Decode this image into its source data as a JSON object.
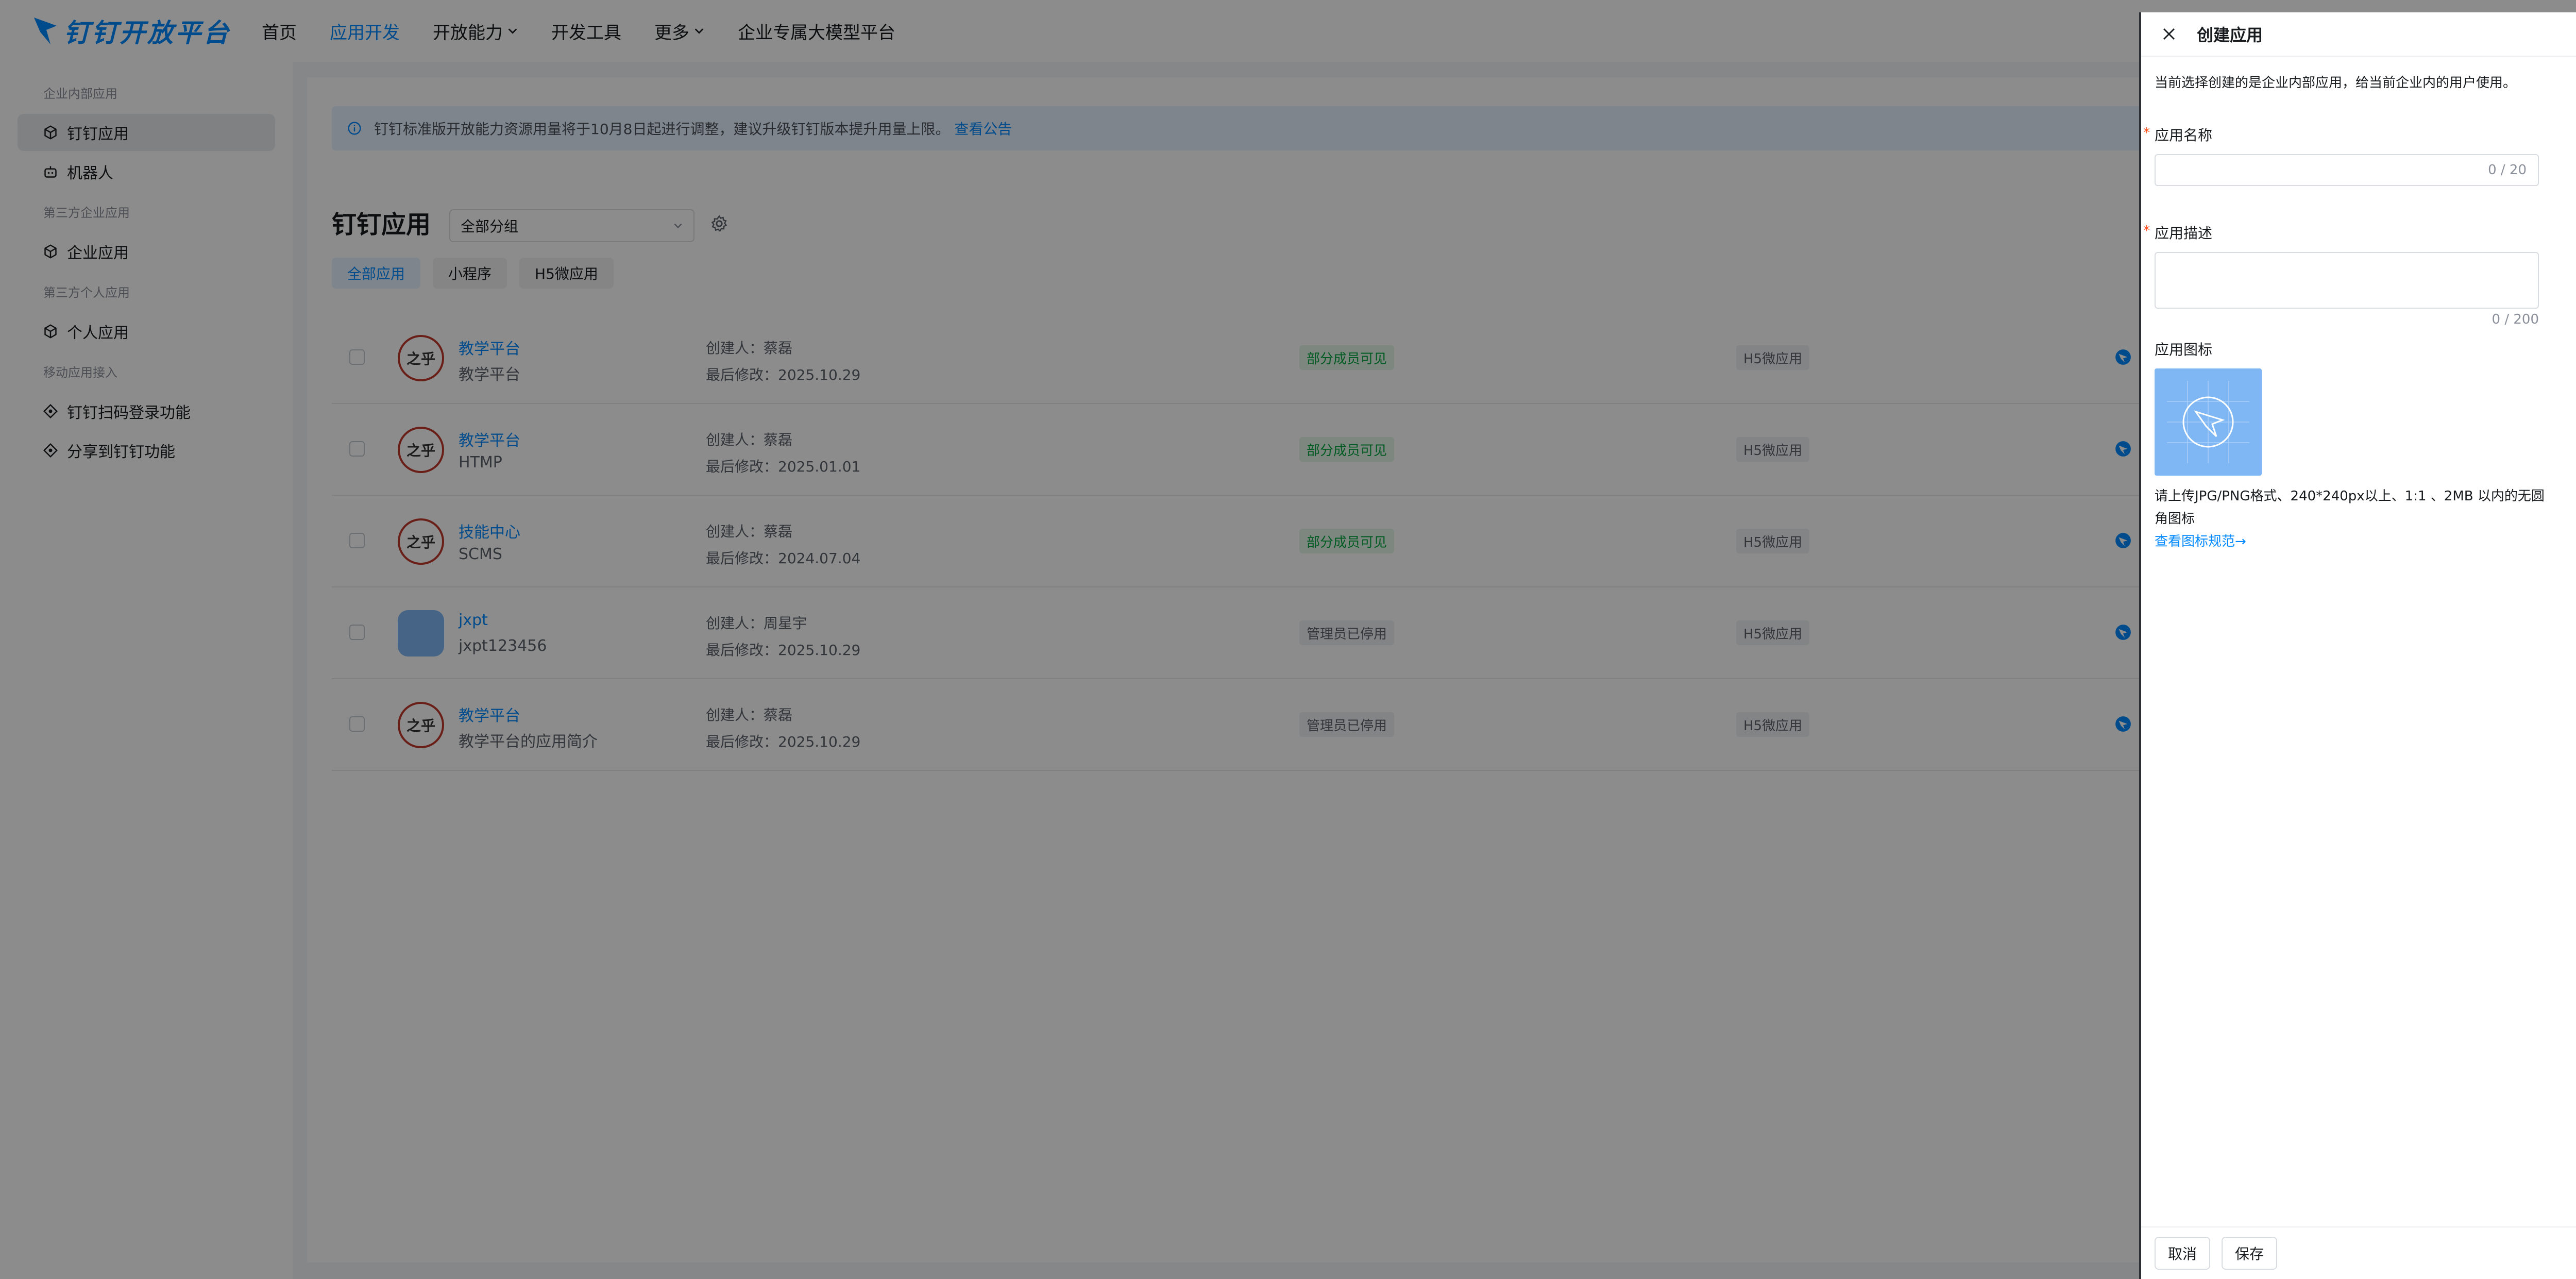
{
  "nav": {
    "logo_text": "钉钉开放平台",
    "items": [
      {
        "label": "首页",
        "active": false,
        "dropdown": false
      },
      {
        "label": "应用开发",
        "active": true,
        "dropdown": false
      },
      {
        "label": "开放能力",
        "active": false,
        "dropdown": true
      },
      {
        "label": "开发工具",
        "active": false,
        "dropdown": false
      },
      {
        "label": "更多",
        "active": false,
        "dropdown": true
      },
      {
        "label": "企业专属大模型平台",
        "active": false,
        "dropdown": false
      }
    ]
  },
  "sidebar": {
    "group1": "企业内部应用",
    "item_dingapp": "钉钉应用",
    "item_robot": "机器人",
    "group2": "第三方企业应用",
    "item_enterprise": "企业应用",
    "group3": "第三方个人应用",
    "item_personal": "个人应用",
    "group4": "移动应用接入",
    "item_scanlogin": "钉钉扫码登录功能",
    "item_share": "分享到钉钉功能"
  },
  "main": {
    "notice_text": "钉钉标准版开放能力资源用量将于10月8日起进行调整，建议升级钉钉版本提升用量上限。",
    "notice_link": "查看公告",
    "title": "钉钉应用",
    "group_select": "全部分组",
    "tabs": [
      "全部应用",
      "小程序",
      "H5微应用"
    ],
    "rows": [
      {
        "icon": "之乎",
        "name": "教学平台",
        "desc": "教学平台",
        "creator": "创建人：蔡磊",
        "modified": "最后修改：2025.10.29",
        "status": "部分成员可见",
        "status_type": "green",
        "type": "H5微应用"
      },
      {
        "icon": "之乎",
        "name": "教学平台",
        "desc": "HTMP",
        "creator": "创建人：蔡磊",
        "modified": "最后修改：2025.01.01",
        "status": "部分成员可见",
        "status_type": "green",
        "type": "H5微应用"
      },
      {
        "icon": "之乎",
        "name": "技能中心",
        "desc": "SCMS",
        "creator": "创建人：蔡磊",
        "modified": "最后修改：2024.07.04",
        "status": "部分成员可见",
        "status_type": "green",
        "type": "H5微应用"
      },
      {
        "icon": "",
        "name": "jxpt",
        "desc": "jxpt123456",
        "creator": "创建人：周星宇",
        "modified": "最后修改：2025.10.29",
        "status": "管理员已停用",
        "status_type": "gray",
        "type": "H5微应用"
      },
      {
        "icon": "之乎",
        "name": "教学平台",
        "desc": "教学平台的应用简介",
        "creator": "创建人：蔡磊",
        "modified": "最后修改：2025.10.29",
        "status": "管理员已停用",
        "status_type": "gray",
        "type": "H5微应用"
      }
    ]
  },
  "drawer": {
    "title": "创建应用",
    "hint": "当前选择创建的是企业内部应用，给当前企业内的用户使用。",
    "name_label": "应用名称",
    "name_count": "0 / 20",
    "desc_label": "应用描述",
    "desc_count": "0 / 200",
    "icon_label": "应用图标",
    "icon_hint": "请上传JPG/PNG格式、240*240px以上、1:1 、2MB 以内的无圆角图标",
    "icon_link": "查看图标规范→",
    "required_mark": "*",
    "cancel": "取消",
    "save": "保存"
  }
}
